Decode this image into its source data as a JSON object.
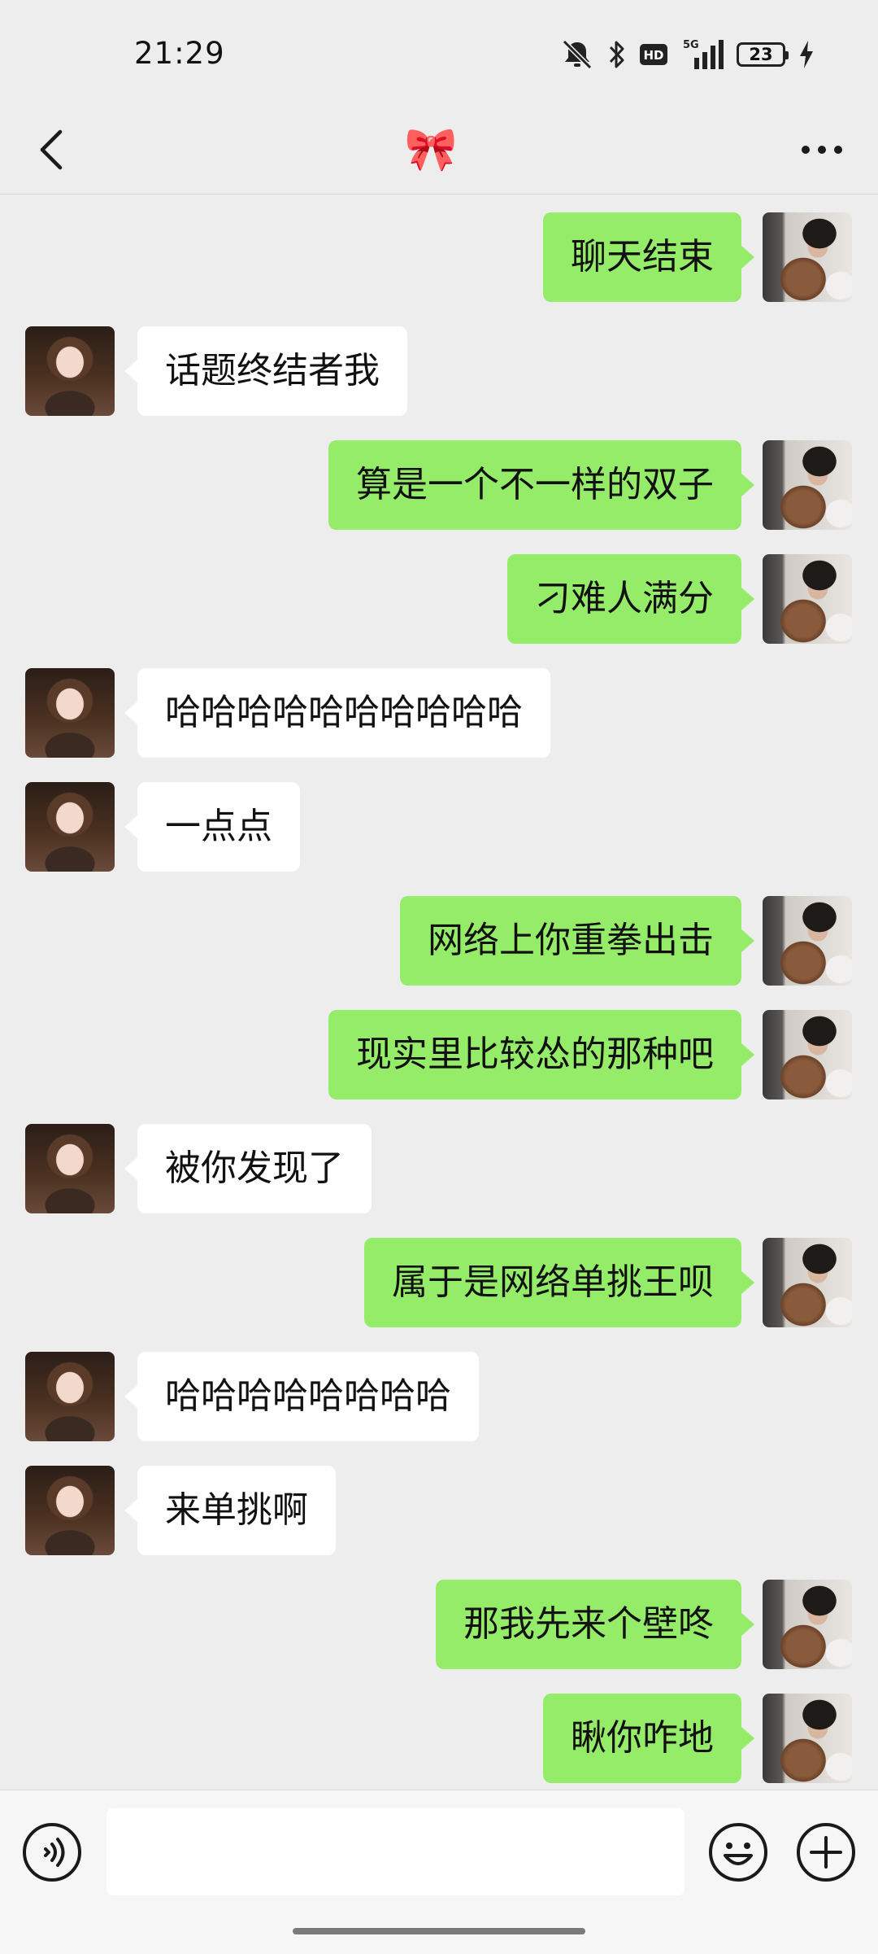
{
  "status_bar": {
    "time": "21:29",
    "network_label": "5G",
    "hd_label": "HD",
    "battery_level": "23",
    "icons": [
      "mute-bell-icon",
      "bluetooth-icon",
      "hd-icon",
      "signal-5g-icon",
      "battery-icon",
      "charging-bolt-icon"
    ]
  },
  "header": {
    "title": "🎀",
    "back_icon": "chevron-left-icon",
    "more_icon": "more-dots-icon"
  },
  "colors": {
    "background": "#ededed",
    "outgoing_bubble": "#95ec69",
    "incoming_bubble": "#ffffff"
  },
  "messages": [
    {
      "side": "right",
      "text": "聊天结束"
    },
    {
      "side": "left",
      "text": "话题终结者我"
    },
    {
      "side": "right",
      "text": "算是一个不一样的双子"
    },
    {
      "side": "right",
      "text": "刁难人满分"
    },
    {
      "side": "left",
      "text": "哈哈哈哈哈哈哈哈哈哈"
    },
    {
      "side": "left",
      "text": "一点点"
    },
    {
      "side": "right",
      "text": "网络上你重拳出击"
    },
    {
      "side": "right",
      "text": "现实里比较怂的那种吧"
    },
    {
      "side": "left",
      "text": "被你发现了"
    },
    {
      "side": "right",
      "text": "属于是网络单挑王呗"
    },
    {
      "side": "left",
      "text": "哈哈哈哈哈哈哈哈"
    },
    {
      "side": "left",
      "text": "来单挑啊"
    },
    {
      "side": "right",
      "text": "那我先来个壁咚"
    },
    {
      "side": "right",
      "text": "瞅你咋地"
    }
  ],
  "input_bar": {
    "value": "",
    "icons": [
      "voice-icon",
      "emoji-icon",
      "plus-icon"
    ]
  }
}
